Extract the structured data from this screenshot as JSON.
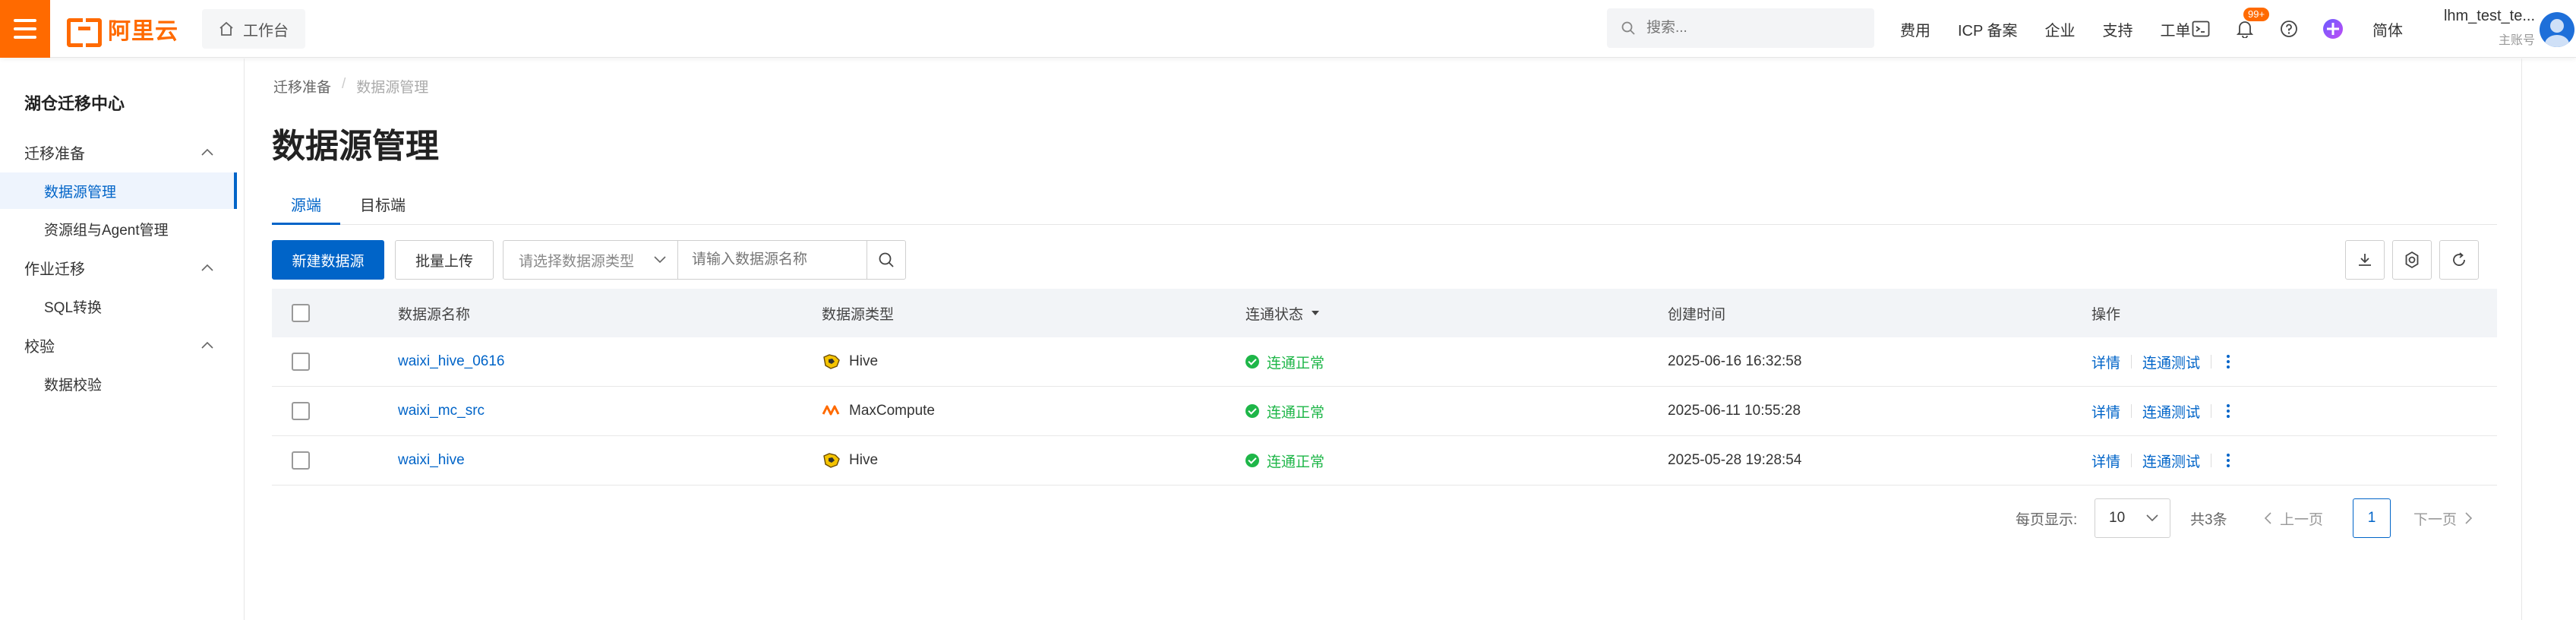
{
  "topbar": {
    "logo_text": "阿里云",
    "workbench": "工作台",
    "search_placeholder": "搜索...",
    "nav": [
      "费用",
      "ICP 备案",
      "企业",
      "支持",
      "工单"
    ],
    "notification_badge": "99+",
    "language": "简体",
    "user_name": "lhm_test_te...",
    "user_role": "主账号"
  },
  "sidebar": {
    "title": "湖仓迁移中心",
    "groups": [
      {
        "label": "迁移准备",
        "items": [
          "数据源管理",
          "资源组与Agent管理"
        ]
      },
      {
        "label": "作业迁移",
        "items": [
          "SQL转换"
        ]
      },
      {
        "label": "校验",
        "items": [
          "数据校验"
        ]
      }
    ],
    "active_item": "数据源管理"
  },
  "breadcrumb": [
    "迁移准备",
    "数据源管理"
  ],
  "page_title": "数据源管理",
  "tabs": [
    "源端",
    "目标端"
  ],
  "toolbar": {
    "new_button": "新建数据源",
    "upload_button": "批量上传",
    "type_select_placeholder": "请选择数据源类型",
    "name_input_placeholder": "请输入数据源名称"
  },
  "table": {
    "columns": [
      "数据源名称",
      "数据源类型",
      "连通状态",
      "创建时间",
      "操作"
    ],
    "rows": [
      {
        "name": "waixi_hive_0616",
        "type": "Hive",
        "status": "连通正常",
        "created": "2025-06-16 16:32:58",
        "ops": [
          "详情",
          "连通测试"
        ]
      },
      {
        "name": "waixi_mc_src",
        "type": "MaxCompute",
        "status": "连通正常",
        "created": "2025-06-11 10:55:28",
        "ops": [
          "详情",
          "连通测试"
        ]
      },
      {
        "name": "waixi_hive",
        "type": "Hive",
        "status": "连通正常",
        "created": "2025-05-28 19:28:54",
        "ops": [
          "详情",
          "连通测试"
        ]
      }
    ]
  },
  "pagination": {
    "page_size_label": "每页显示:",
    "page_size": "10",
    "total": "共3条",
    "prev": "上一页",
    "current_page": "1",
    "next": "下一页"
  },
  "colors": {
    "brand": "#ff6a00",
    "primary": "#0064c8",
    "success": "#1eb648"
  }
}
